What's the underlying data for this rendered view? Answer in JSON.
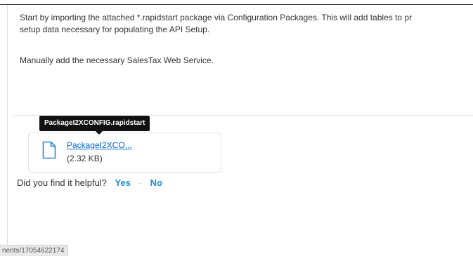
{
  "article": {
    "paragraph1_line1": "Start by importing the attached *.rapidstart package via Configuration Packages.  This will add tables to pr",
    "paragraph1_line2": "setup data necessary for populating the API Setup.",
    "paragraph2": "Manually add the necessary SalesTax Web Service."
  },
  "attachment": {
    "tooltip": "PackageI2XCONFIG.rapidstart",
    "name": "PackageI2XCO...",
    "size": "(2.32 KB)",
    "icon": "file-icon"
  },
  "feedback": {
    "question": "Did you find it helpful?",
    "yes_label": "Yes",
    "separator": "-",
    "no_label": "No"
  },
  "status_bar": {
    "url": "nents/17054622174"
  },
  "colors": {
    "link": "#0066cc",
    "feedback_button": "#1a8cd8",
    "tooltip_background": "#111111"
  }
}
